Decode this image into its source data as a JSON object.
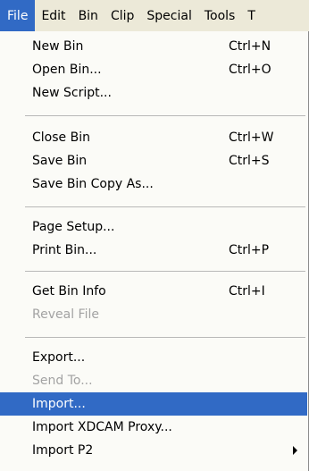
{
  "menubar": {
    "items": [
      "File",
      "Edit",
      "Bin",
      "Clip",
      "Special",
      "Tools",
      "T"
    ]
  },
  "file_menu": {
    "new_bin": {
      "label": "New Bin",
      "shortcut": "Ctrl+N"
    },
    "open_bin": {
      "label": "Open Bin...",
      "shortcut": "Ctrl+O"
    },
    "new_script": {
      "label": "New Script..."
    },
    "close_bin": {
      "label": "Close Bin",
      "shortcut": "Ctrl+W"
    },
    "save_bin": {
      "label": "Save Bin",
      "shortcut": "Ctrl+S"
    },
    "save_bin_copy_as": {
      "label": "Save Bin Copy As..."
    },
    "page_setup": {
      "label": "Page Setup..."
    },
    "print_bin": {
      "label": "Print Bin...",
      "shortcut": "Ctrl+P"
    },
    "get_bin_info": {
      "label": "Get Bin Info",
      "shortcut": "Ctrl+I"
    },
    "reveal_file": {
      "label": "Reveal File",
      "enabled": false
    },
    "export": {
      "label": "Export..."
    },
    "send_to": {
      "label": "Send To...",
      "enabled": false
    },
    "import": {
      "label": "Import...",
      "highlighted": true
    },
    "import_xdcam_proxy": {
      "label": "Import XDCAM Proxy..."
    },
    "import_p2": {
      "label": "Import P2",
      "has_submenu": true,
      "icon": "submenu-arrow-icon"
    }
  },
  "colors": {
    "menubar_background": "#ece9d8",
    "menu_background": "#fbfbf7",
    "highlight": "#316ac5",
    "disabled_text": "#a3a3a3"
  }
}
